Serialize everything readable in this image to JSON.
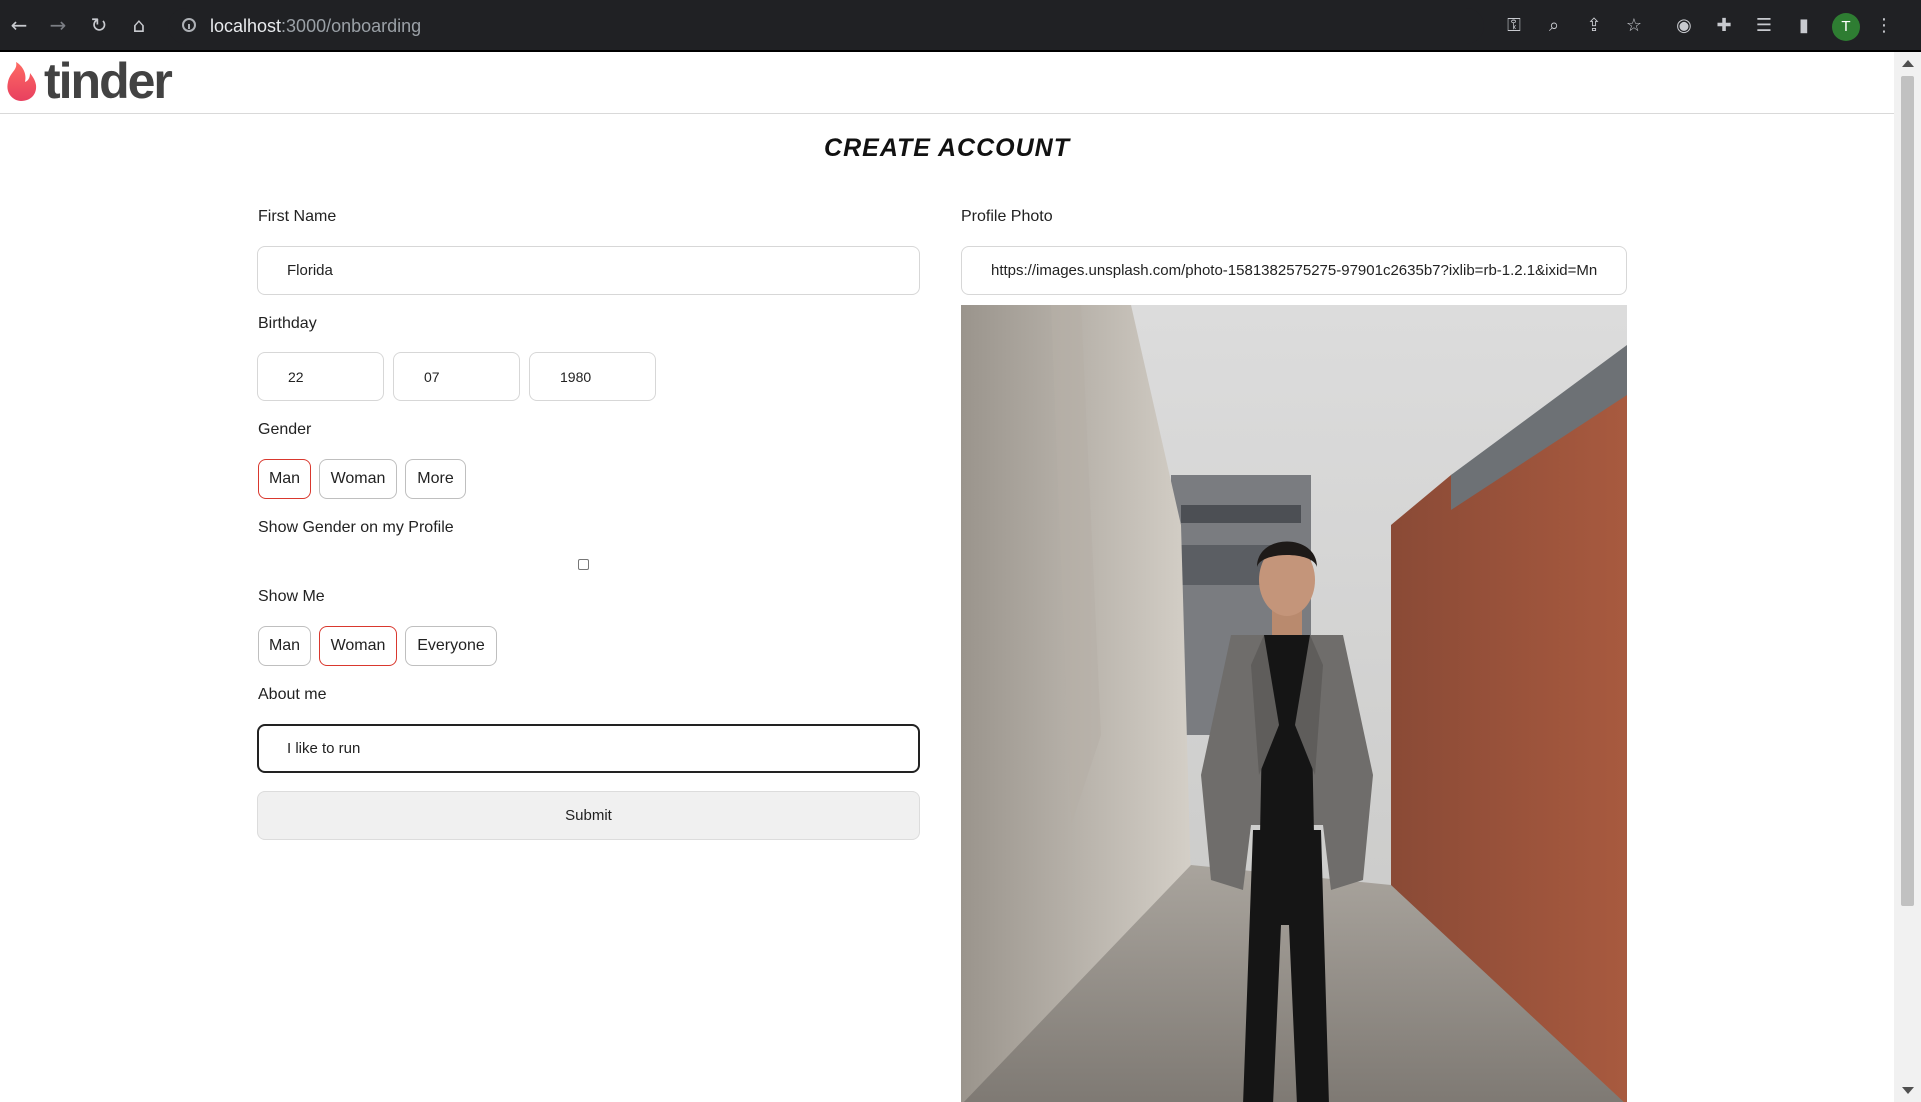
{
  "browser": {
    "url_host": "localhost",
    "url_rest": ":3000/onboarding",
    "profile_initial": "T"
  },
  "app": {
    "logo_text": "tinder",
    "brand_colors": {
      "flame_top": "#fd5068",
      "flame_bottom": "#ef4a5a"
    }
  },
  "form": {
    "title": "CREATE ACCOUNT",
    "first_name": {
      "label": "First Name",
      "value": "Florida"
    },
    "birthday": {
      "label": "Birthday",
      "day": "22",
      "month": "07",
      "year": "1980"
    },
    "gender": {
      "label": "Gender",
      "options": [
        "Man",
        "Woman",
        "More"
      ],
      "selected": "Man"
    },
    "show_gender": {
      "label": "Show Gender on my Profile",
      "checked": false
    },
    "show_me": {
      "label": "Show Me",
      "options": [
        "Man",
        "Woman",
        "Everyone"
      ],
      "selected": "Woman"
    },
    "about": {
      "label": "About me",
      "value": "I like to run"
    },
    "submit_label": "Submit",
    "profile_photo": {
      "label": "Profile Photo",
      "url": "https://images.unsplash.com/photo-1581382575275-97901c2635b7?ixlib=rb-1.2.1&ixid=Mn"
    }
  },
  "accent_color": "#d9382e"
}
